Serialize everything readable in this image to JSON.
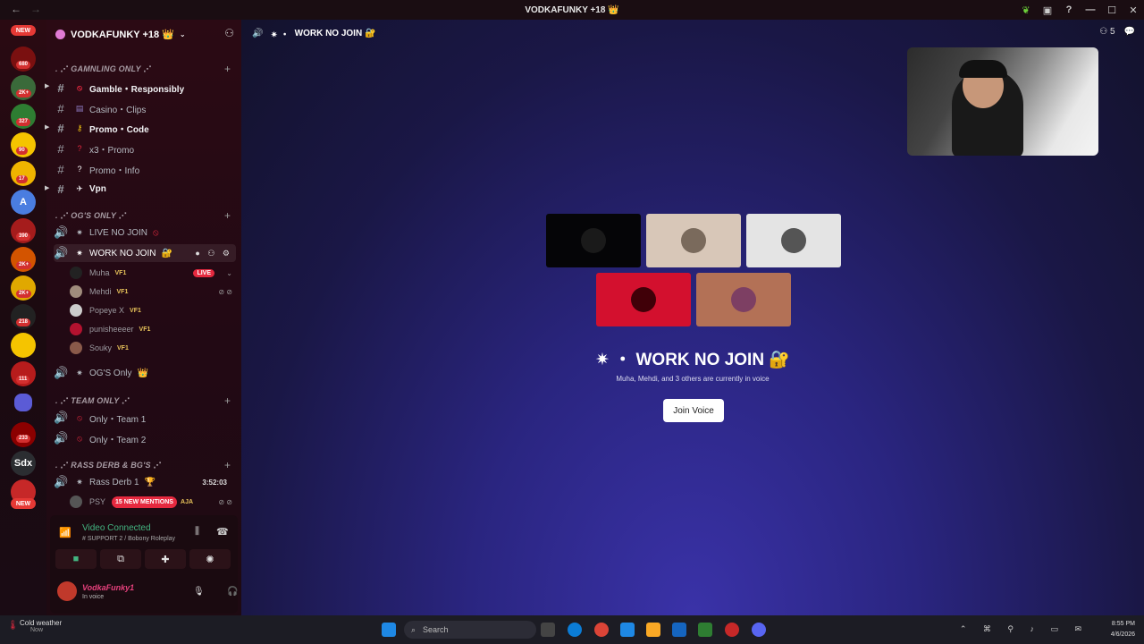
{
  "window": {
    "title": "VODKAFUNKY +18 👑"
  },
  "rail": {
    "new_top": "NEW",
    "new_bottom": "NEW",
    "badges": [
      "680",
      "2K+",
      "327",
      "90",
      "17",
      "390",
      "2K+",
      "2K+",
      "218",
      "111",
      "233"
    ],
    "text_server": "Sdx",
    "letter_server": "A"
  },
  "guild": {
    "name": "VODKAFUNKY +18 👑"
  },
  "categories": {
    "gamb": ". ⋰ GAMNLING ONLY ⋰",
    "og": ". ⋰ OG'S ONLY ⋰",
    "team": ". ⋰ TEAM ONLY ⋰",
    "rass": ". ⋰ RASS DERB & BG'S ⋰"
  },
  "channels": {
    "gamble": "Gamble・Responsibly",
    "casino": "Casino・Clips",
    "promo_code": "Promo・Code",
    "x3_promo": "x3・Promo",
    "promo_info": "Promo・Info",
    "vpn": "Vpn",
    "live_no_join": "LIVE NO JOIN",
    "work_no_join": "WORK NO JOIN",
    "ogs_only": "OG'S Only",
    "team1": "Only・Team 1",
    "team2": "Only・Team 2",
    "rass_derb": "Rass Derb 1"
  },
  "voice_users": [
    {
      "name": "Muha",
      "tag": "VF1"
    },
    {
      "name": "Mehdi",
      "tag": "VF1"
    },
    {
      "name": "Popeye X",
      "tag": "VF1"
    },
    {
      "name": "punisheeeer",
      "tag": "VF1"
    },
    {
      "name": "Souky",
      "tag": "VF1"
    }
  ],
  "live_label": "LIVE",
  "rass_timer": "3:52:03",
  "rass_user": "PSY",
  "rass_user_suffix": "AJA",
  "mentions": "15 NEW MENTIONS",
  "voice_panel": {
    "title": "Video Connected",
    "subtitle": "# SUPPORT 2 / Bobony Roleplay"
  },
  "user": {
    "name": "VodkaFunky1",
    "status": "In voice"
  },
  "main": {
    "header": "WORK NO JOIN 🔐",
    "member_count": "5",
    "channel_title": "WORK NO JOIN",
    "in_voice": "Muha, Mehdi, and 3 others are currently in voice",
    "join_button": "Join Voice"
  },
  "taskbar": {
    "weather_title": "Cold weather",
    "weather_sub": "Now",
    "search": "Search",
    "time": "8:55 PM",
    "date": "4/6/2026"
  },
  "colors": {
    "accent_red": "#e5293f",
    "voice_green": "#43b581",
    "main_bg": "#2a2580"
  }
}
